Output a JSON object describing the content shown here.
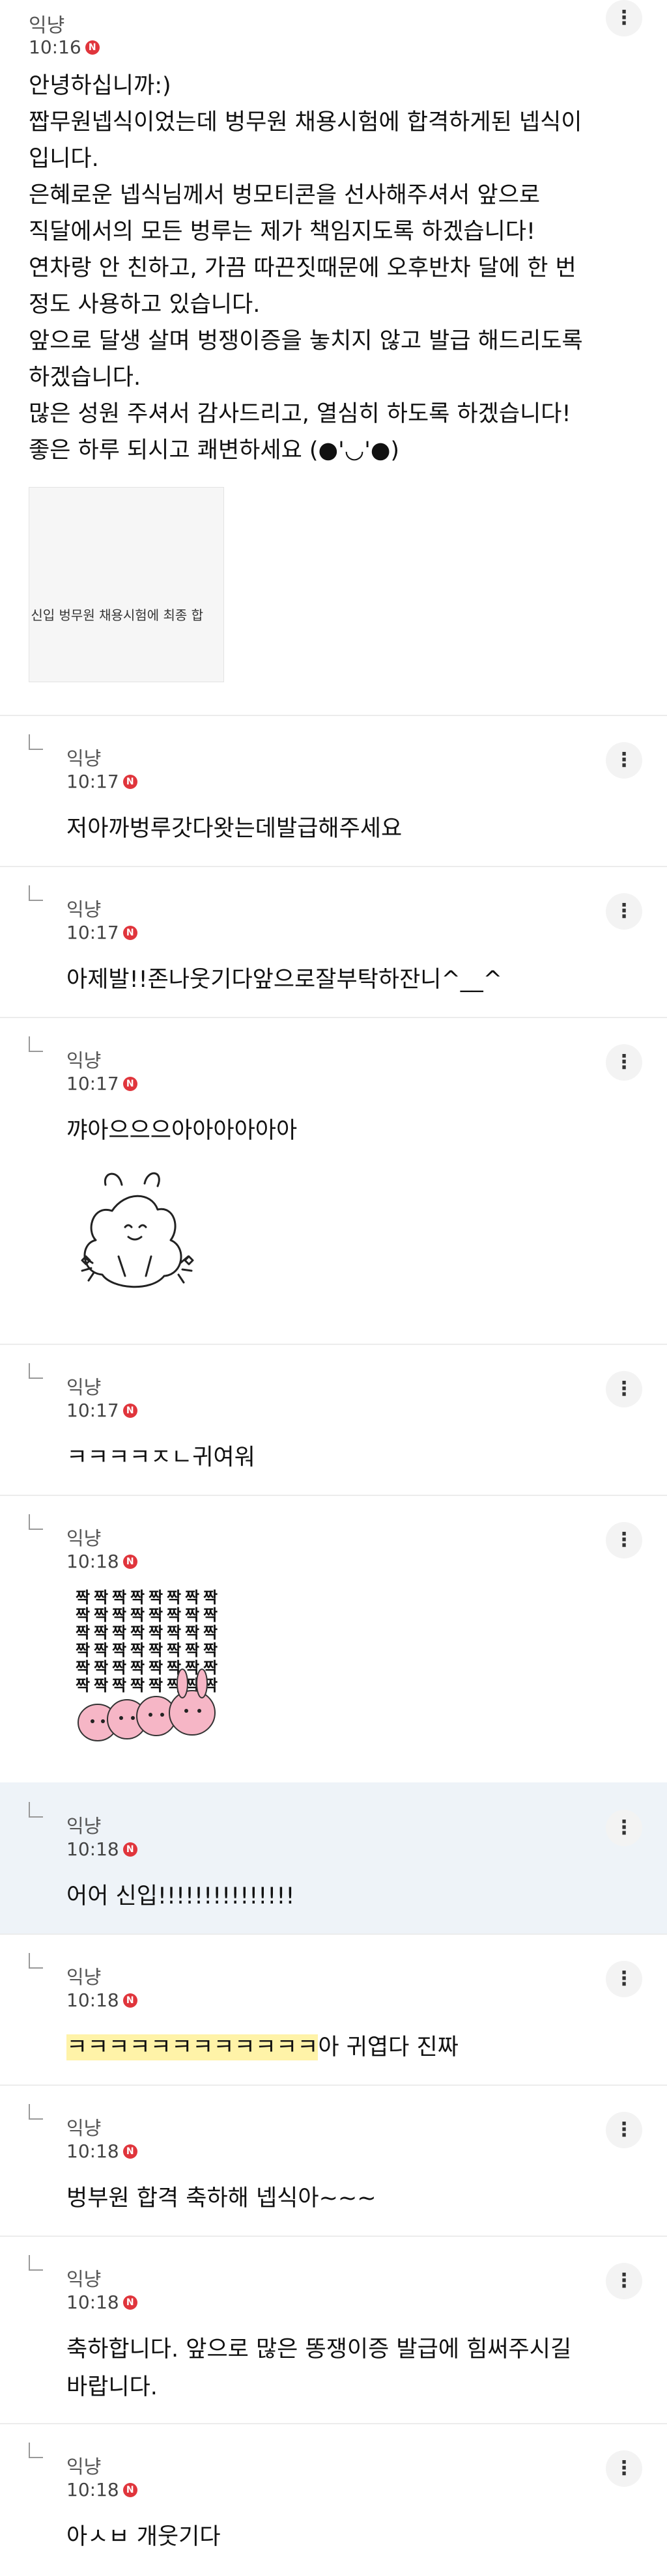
{
  "post": {
    "author": "익냥",
    "time": "10:16",
    "badge": "N",
    "more_icon": "⋮",
    "lines": [
      "안녕하십니까:)",
      "짭무원넵식이었는데 벙무원 채용시험에 합격하게된 넵식이",
      "입니다.",
      "은혜로운 넵식님께서 벙모티콘을 선사해주셔서 앞으로",
      "직달에서의 모든 벙루는 제가 책임지도록 하겠습니다!",
      "연차랑 안 친하고, 가끔 따끈짓때문에 오후반차 달에 한 번",
      "정도 사용하고 있습니다.",
      "앞으로 달생 살며 벙쟁이증을 놓치지 않고 발급 해드리도록",
      "하겠습니다.",
      "많은 성원 주셔서 감사드리고, 열심히 하도록 하겠습니다!",
      "좋은 하루 되시고 쾌변하세요 (●'◡'●)"
    ],
    "image_caption": "! 신입 벙무원 채용시험에 최종 합"
  },
  "comments": [
    {
      "author": "익냥",
      "time": "10:17",
      "badge": "N",
      "more_icon": "⋮",
      "text_lines": [
        "저아까벙루갓다왓는데발급해주세요"
      ]
    },
    {
      "author": "익냥",
      "time": "10:17",
      "badge": "N",
      "more_icon": "⋮",
      "text_lines": [
        "아제발!!존나웃기다앞으로잘부탁하잔니^__^"
      ]
    },
    {
      "author": "익냥",
      "time": "10:17",
      "badge": "N",
      "more_icon": "⋮",
      "text_lines": [
        "꺄아으으으아아아아아아"
      ],
      "sticker": "cheering-bunny-sticker"
    },
    {
      "author": "익냥",
      "time": "10:17",
      "badge": "N",
      "more_icon": "⋮",
      "text_lines": [
        "ㅋㅋㅋㅋㅈㄴ귀여워"
      ]
    },
    {
      "author": "익냥",
      "time": "10:18",
      "badge": "N",
      "more_icon": "⋮",
      "text_lines": [],
      "sticker": "clapping-bunnies-sticker",
      "sticker_word": "짝"
    },
    {
      "author": "익냥",
      "time": "10:18",
      "badge": "N",
      "more_icon": "⋮",
      "text_lines": [
        "어어 신입!!!!!!!!!!!!!!!"
      ]
    },
    {
      "author": "익냥",
      "time": "10:18",
      "badge": "N",
      "more_icon": "⋮",
      "text_highlight": "ㅋㅋㅋㅋㅋㅋㅋㅋㅋㅋㅋㅋ",
      "text_rest": "아 귀엽다 진짜"
    },
    {
      "author": "익냥",
      "time": "10:18",
      "badge": "N",
      "more_icon": "⋮",
      "text_lines": [
        "벙부원 합격 축하해 넵식아~~~"
      ]
    },
    {
      "author": "익냥",
      "time": "10:18",
      "badge": "N",
      "more_icon": "⋮",
      "text_lines": [
        "축하합니다. 앞으로 많은 똥쟁이증 발급에 힘써주시길",
        "바랍니다."
      ]
    },
    {
      "author": "익냥",
      "time": "10:18",
      "badge": "N",
      "more_icon": "⋮",
      "text_lines": [
        "아ㅅㅂ 개웃기다"
      ]
    }
  ]
}
